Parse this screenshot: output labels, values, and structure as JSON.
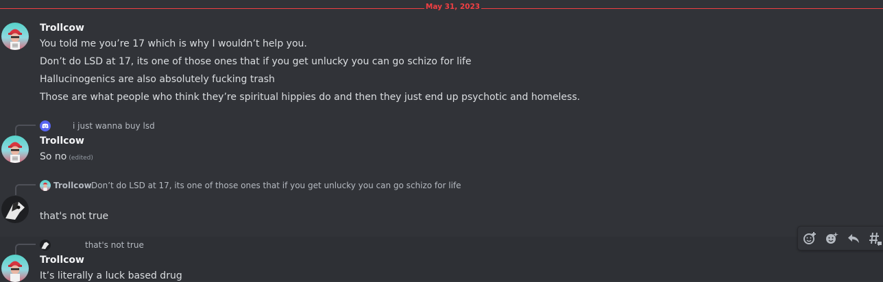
{
  "date_divider": "May 31, 2023",
  "messages": [
    {
      "author": "Trollcow",
      "lines": [
        "You told me you’re 17 which is why I wouldn’t help you.",
        "Don’t do LSD at 17, its one of those ones that if you get unlucky you can go schizo for life",
        "Hallucinogenics are also absolutely fucking trash",
        "Those are what people who think they’re spiritual hippies do and then they just end up psychotic and homeless."
      ]
    },
    {
      "reply_text": "i just wanna buy lsd",
      "author": "Trollcow",
      "text": "So no",
      "edited": "(edited)"
    },
    {
      "reply_author": "Trollcow",
      "reply_text": "Don’t do LSD at 17, its one of those ones that if you get unlucky you can go schizo for life",
      "text": "that's not true"
    },
    {
      "reply_text": "that's not true",
      "author": "Trollcow",
      "text": "It’s literally a luck based drug"
    }
  ],
  "toolbar": {
    "icons": [
      "add-reaction-icon",
      "add-super-reaction-icon",
      "reply-icon",
      "create-thread-icon"
    ]
  },
  "colors": {
    "background": "#313338",
    "divider_red": "#f23f43",
    "text": "#dbdee1",
    "muted": "#b5bac1"
  }
}
